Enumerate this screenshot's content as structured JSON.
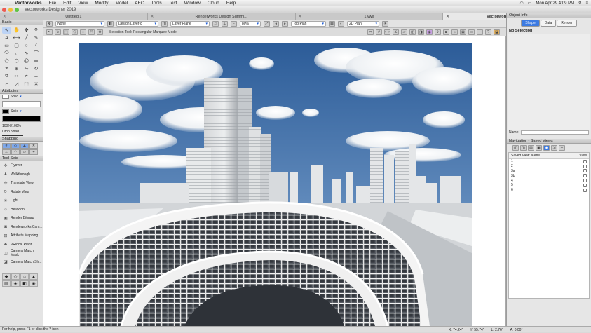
{
  "menubar": {
    "app_name": "Vectorworks",
    "items": [
      "File",
      "Edit",
      "View",
      "Modify",
      "Model",
      "AEC",
      "Tools",
      "Text",
      "Window",
      "Cloud",
      "Help"
    ],
    "clock": "Mon Apr 29  4:09 PM"
  },
  "window": {
    "title": "Vectorworks Designer 2019"
  },
  "tabs": [
    {
      "label": "Untitled 1",
      "active": false
    },
    {
      "label": "Renderworks Design Summi...",
      "active": false
    },
    {
      "label": "1.vwx",
      "active": false
    },
    {
      "label": "vectorworks city renderings.vwx",
      "active": true
    }
  ],
  "toolbar": {
    "class_value": "None",
    "design_layer": "Design Layer-8",
    "layer_plane": "Layer Plane",
    "zoom": "80%",
    "view": "Top/Plan",
    "render_mode": "2D Plan",
    "selection_tool_text": "Selection Tool: Rectangular Marquee Mode"
  },
  "left_palettes": {
    "basic_title": "Basic",
    "attributes_title": "Attributes",
    "fill_label": "Solid",
    "pen_label": "Solid",
    "opacity_label": "100%/100%",
    "drop_shadow_label": "Drop Shad...",
    "snapping_title": "Snapping",
    "tool_sets_title": "Tool Sets",
    "tools": [
      "Flyover",
      "Walkthrough",
      "Translate View",
      "Rotate View",
      "Light",
      "Heliodon",
      "Render Bitmap",
      "Renderworks Cam...",
      "Attribute Mapping",
      "VRlocal Plant",
      "Camera Match Mask",
      "Camera Match Sh..."
    ]
  },
  "object_info": {
    "title": "Object Info",
    "tabs": [
      "Shape",
      "Data",
      "Render"
    ],
    "selection": "No Selection",
    "name_label": "Name:"
  },
  "navigation": {
    "title": "Navigation - Saved Views",
    "col_name": "Saved View Name",
    "col_view": "View",
    "rows": [
      "1",
      "2",
      "3a",
      "3b",
      "4",
      "5",
      "6"
    ]
  },
  "status": {
    "hint": "For help, press F1 or click the ? icon",
    "x_label": "X: 74.24\"",
    "y_label": "Y: 55.74\"",
    "l_label": "L: 2.76\"",
    "a_label": "A: 0.00°"
  },
  "colors": {
    "accent": "#3d7be2",
    "sky_top": "#2c5c98",
    "sky_bottom": "#b5c8dc"
  },
  "icons": [
    "apple-icon",
    "search-icon",
    "wifi-icon",
    "battery-icon",
    "close-icon",
    "arrow-icon",
    "gear-icon",
    "eye-icon",
    "checkbox-icon"
  ]
}
